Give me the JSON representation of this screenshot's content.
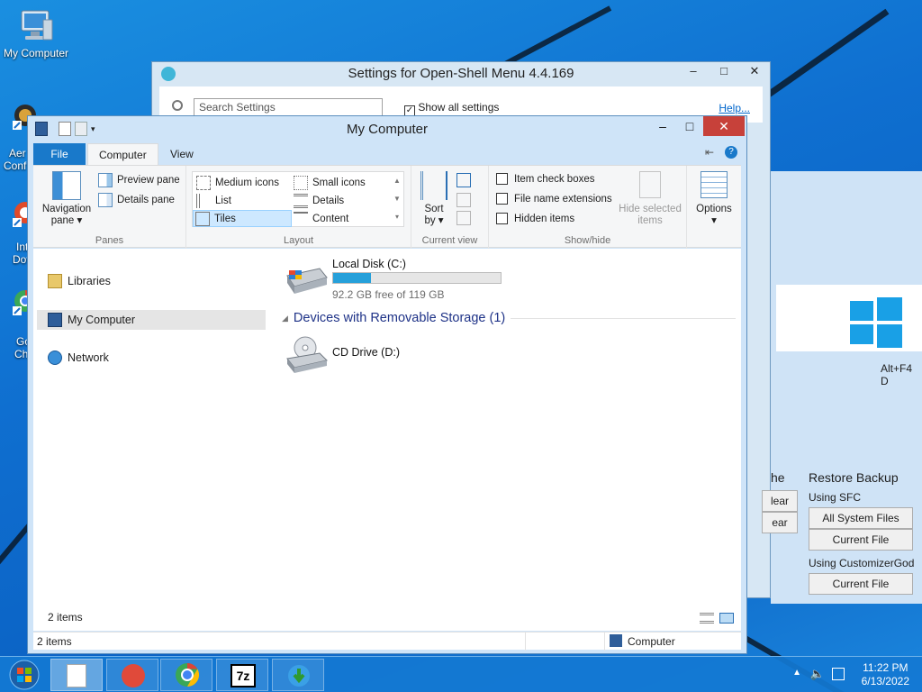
{
  "desktop": {
    "icons": [
      {
        "label": "My Computer"
      }
    ],
    "partial_labels": [
      "Aer",
      "Conf",
      "Int",
      "Dov",
      "Go",
      "Ch"
    ]
  },
  "settings_window": {
    "title": "Settings for Open-Shell Menu 4.4.169",
    "minimize": "–",
    "maximize": "□",
    "close": "✕",
    "search_placeholder": "Search Settings",
    "show_all_label": "Show all settings",
    "help_link": "Help...",
    "shortcut_hint": "Alt+F4 D",
    "partial_left_labels": [
      "he",
      "lear",
      "ear"
    ],
    "restore_backup_heading": "Restore Backup",
    "using_sfc_label": "Using SFC",
    "all_system_files_button": "All System Files",
    "current_file_button_1": "Current File",
    "using_customizergod_label": "Using CustomizerGod",
    "current_file_button_2": "Current File"
  },
  "explorer": {
    "title": "My Computer",
    "window_buttons": {
      "minimize": "–",
      "maximize": "□",
      "close": "✕"
    },
    "tabs": {
      "file": "File",
      "computer": "Computer",
      "view": "View"
    },
    "ribbon": {
      "panes": {
        "navigation_pane": "Navigation",
        "navigation_pane_2": "pane",
        "preview_pane": "Preview pane",
        "details_pane": "Details pane",
        "label": "Panes"
      },
      "layout": {
        "medium_icons": "Medium icons",
        "small_icons": "Small icons",
        "list": "List",
        "details": "Details",
        "tiles": "Tiles",
        "content": "Content",
        "label": "Layout"
      },
      "current_view": {
        "sort_by": "Sort",
        "sort_by_2": "by",
        "label": "Current view"
      },
      "show_hide": {
        "item_check_boxes": "Item check boxes",
        "file_name_extensions": "File name extensions",
        "hidden_items": "Hidden items",
        "hide_selected_items": "Hide selected",
        "hide_selected_items_2": "items",
        "label": "Show/hide"
      },
      "options": {
        "label": "Options"
      }
    },
    "nav": {
      "libraries": "Libraries",
      "my_computer": "My Computer",
      "network": "Network"
    },
    "drives": {
      "local_disk_name": "Local Disk (C:)",
      "local_disk_free": "92.2 GB free of 119 GB",
      "local_disk_used_fraction": 0.225,
      "removable_group": "Devices with Removable Storage (1)",
      "cd_drive_name": "CD Drive (D:)"
    },
    "inner_status": "2 items",
    "status_left": "2 items",
    "status_right": "Computer"
  },
  "taskbar": {
    "clock_time": "11:22 PM",
    "clock_date": "6/13/2022",
    "apps": [
      "file",
      "shell-settings",
      "chrome",
      "7zip",
      "download-manager"
    ],
    "zip_label": "7z"
  }
}
